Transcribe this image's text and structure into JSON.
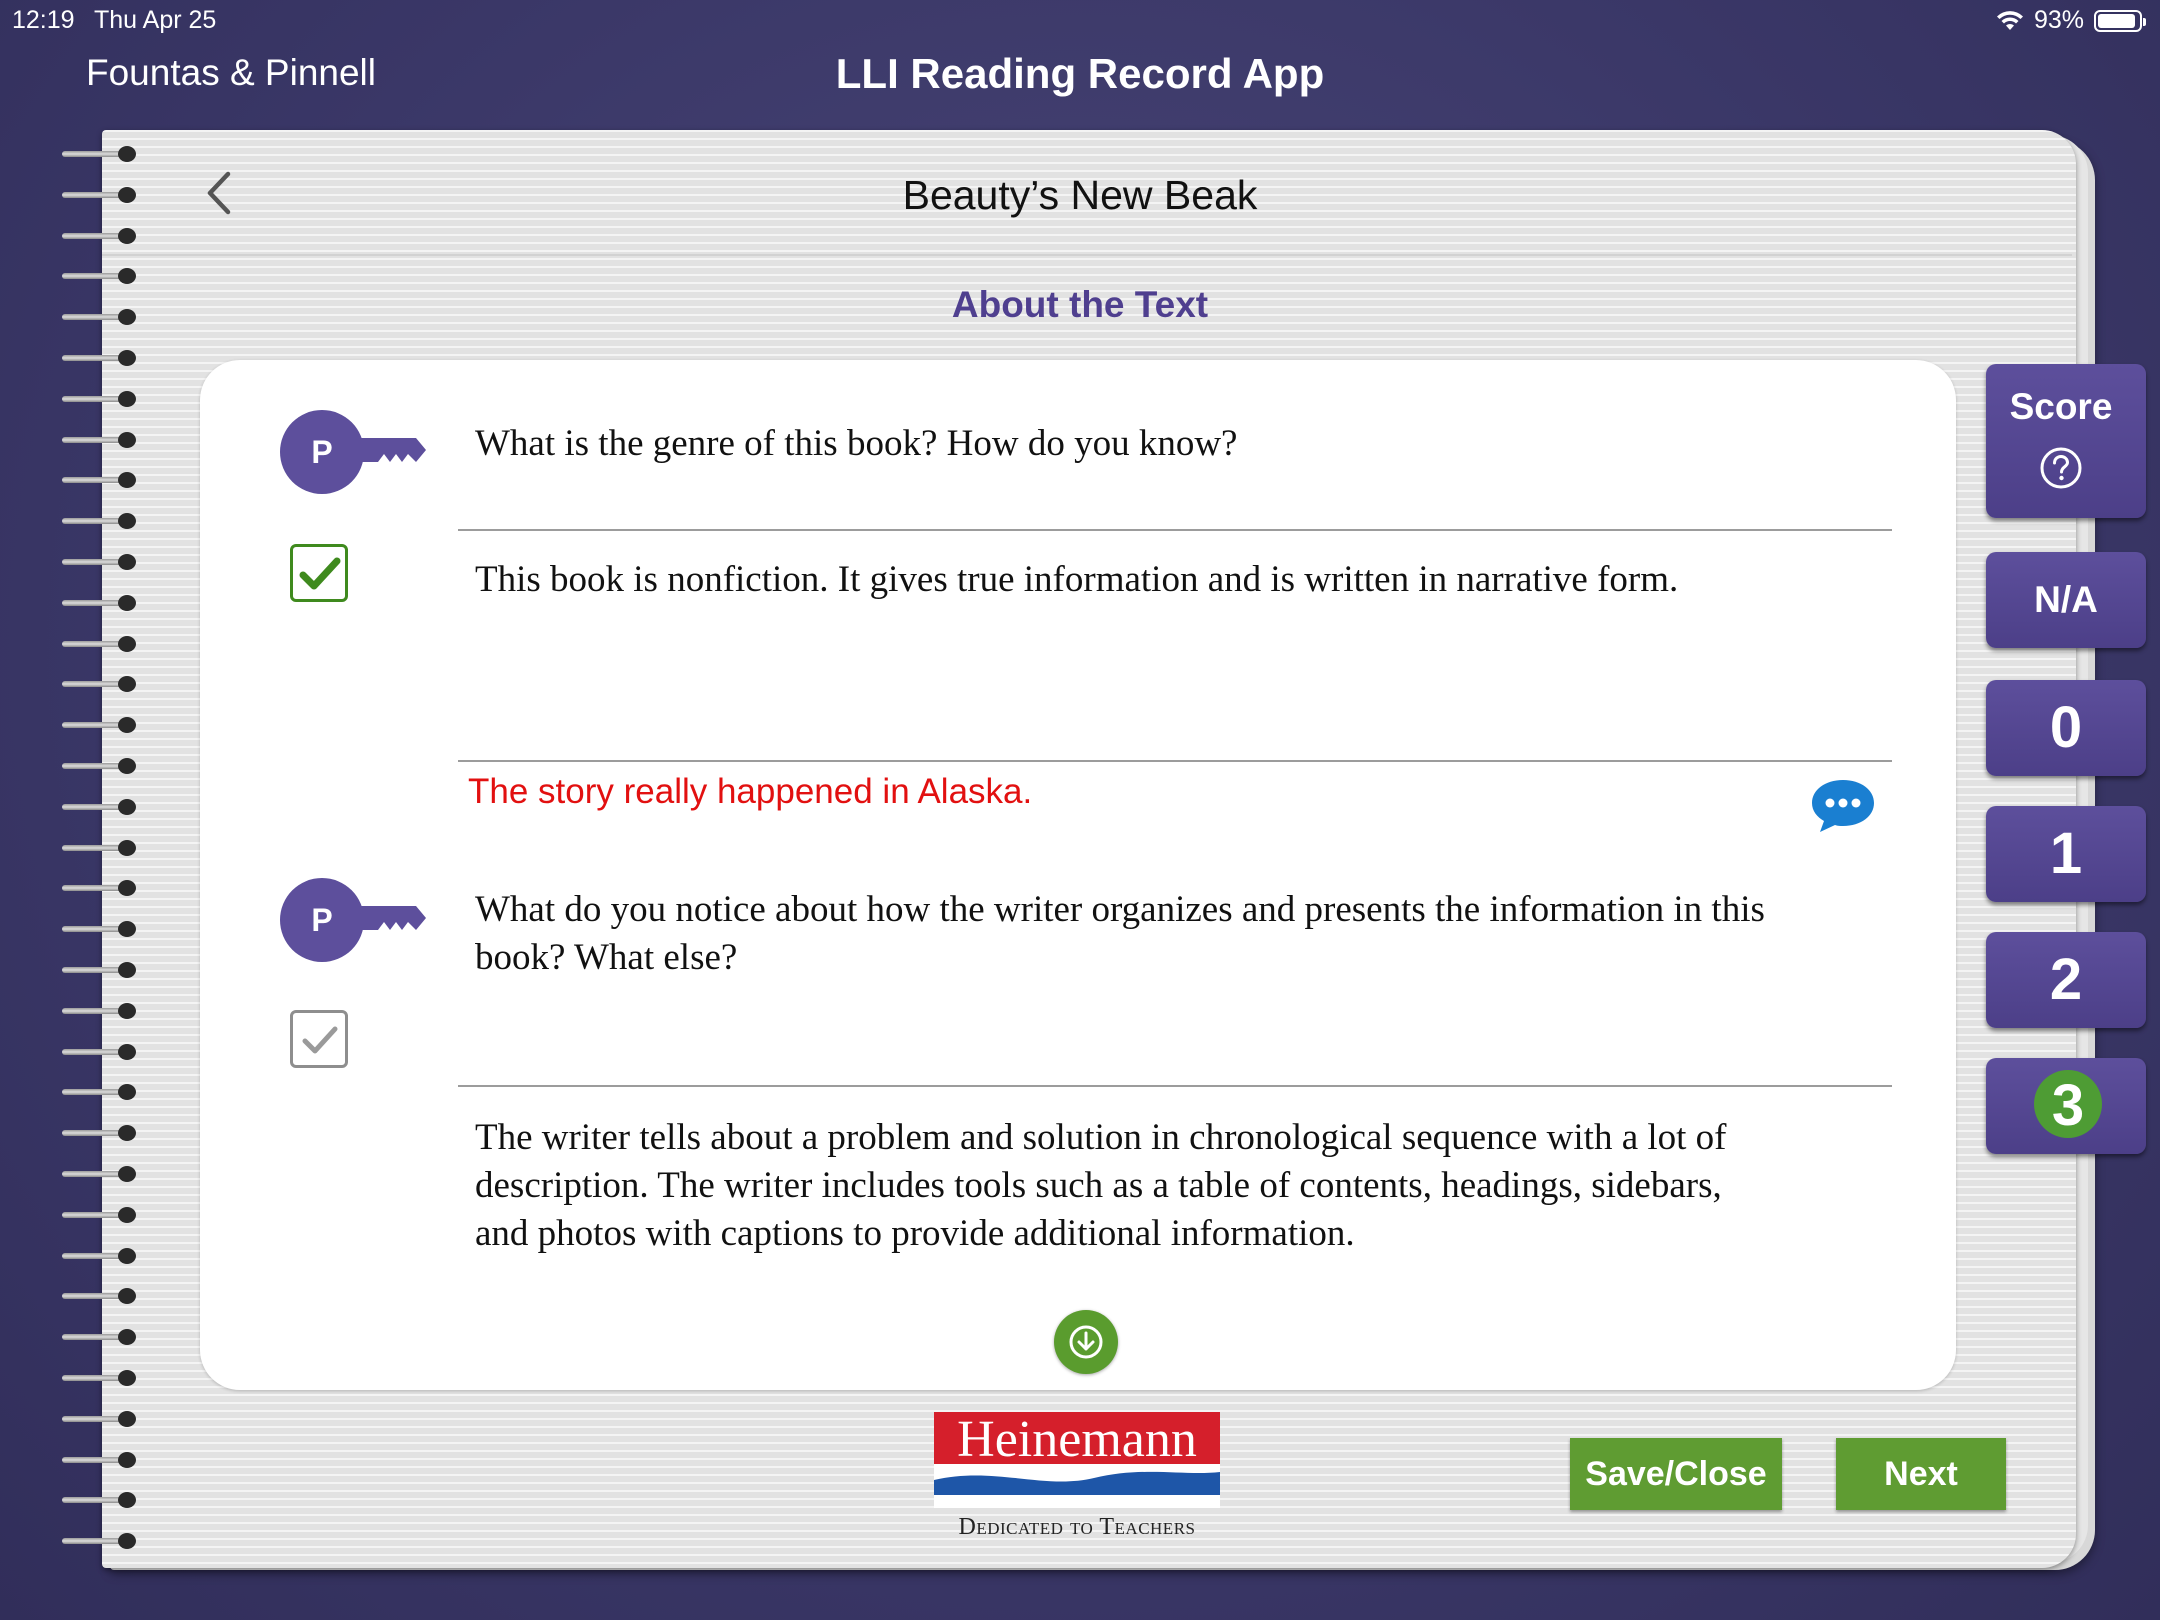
{
  "status_bar": {
    "time": "12:19",
    "date": "Thu Apr 25",
    "battery": "93%",
    "battery_level": 0.93
  },
  "app": {
    "brand": "Fountas & Pinnell",
    "title": "LLI Reading Record App"
  },
  "page": {
    "book_title": "Beauty’s New Beak",
    "section_title": "About the Text"
  },
  "questions": [
    {
      "key_label": "P",
      "checked": true,
      "prompt": "What is the genre of this book? How do you know?",
      "answer": "This book is nonfiction. It gives true information and is written in narrative form.",
      "note": "The story really happened in Alaska."
    },
    {
      "key_label": "P",
      "checked": false,
      "prompt_line1": "What do you notice about how the writer organizes and presents the information in this",
      "prompt_line2": "book? What else?",
      "answer_line1": "The writer tells about a problem and solution in chronological sequence with a lot of",
      "answer_line2": "description. The writer includes tools such as a table of contents, headings, sidebars,",
      "answer_line3": "and photos with captions to provide additional information."
    }
  ],
  "score_panel": {
    "label": "Score",
    "options": [
      "N/A",
      "0",
      "1",
      "2",
      "3"
    ],
    "selected": "3"
  },
  "logo": {
    "name": "Heinemann",
    "tagline": "Dedicated to Teachers"
  },
  "buttons": {
    "save_close": "Save/Close",
    "next": "Next"
  },
  "colors": {
    "accent_purple": "#4f3f8f",
    "button_green": "#5f9c32",
    "note_red": "#e21010",
    "background": "#3a3767"
  }
}
